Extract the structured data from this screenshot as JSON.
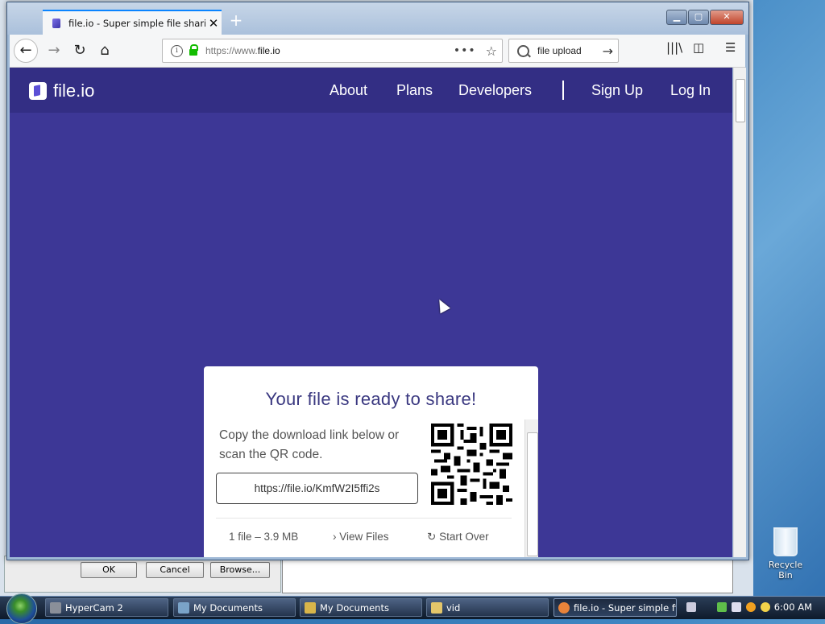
{
  "browser": {
    "tab_title": "file.io - Super simple file sharing",
    "url_prefix": "https://www.",
    "url_domain": "file.io",
    "search_query": "file upload"
  },
  "site": {
    "logo_text": "file.io",
    "nav": {
      "about": "About",
      "plans": "Plans",
      "developers": "Developers",
      "signup": "Sign Up",
      "login": "Log In"
    }
  },
  "card": {
    "title": "Your file is ready to share!",
    "description": "Copy the download link below or scan the QR code.",
    "link": "https://file.io/KmfW2I5ffi2s",
    "file_info": "1 file – 3.9 MB",
    "view_files": "View Files",
    "start_over": "Start Over"
  },
  "background_dialog": {
    "ok": "OK",
    "cancel": "Cancel",
    "browse": "Browse..."
  },
  "desktop": {
    "recycle_bin": "Recycle Bin"
  },
  "taskbar": {
    "items": [
      "HyperCam 2",
      "My Documents",
      "My Documents",
      "vid",
      "file.io - Super simple fil..."
    ],
    "clock": "6:00 AM"
  },
  "colors": {
    "brand_nav": "#332e84",
    "brand_bg": "#3d3796",
    "title_color": "#3a3880"
  },
  "icons": [
    "back-icon",
    "forward-icon",
    "reload-icon",
    "home-icon",
    "info-icon",
    "lock-icon",
    "star-icon",
    "search-icon",
    "library-icon",
    "sidebar-icon",
    "menu-icon"
  ]
}
